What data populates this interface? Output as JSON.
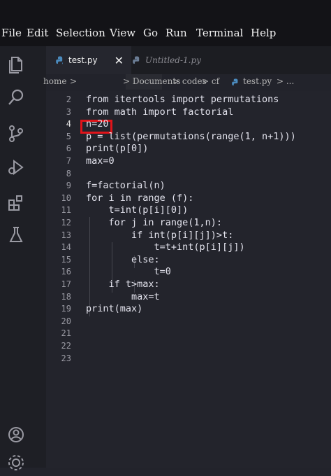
{
  "menu": {
    "items": [
      "File",
      "Edit",
      "Selection",
      "View",
      "Go",
      "Run",
      "Terminal",
      "Help"
    ]
  },
  "activity_bar": {
    "icons": [
      "files-icon",
      "search-icon",
      "source-control-icon",
      "run-debug-icon",
      "extensions-icon",
      "testing-icon",
      "account-icon",
      "settings-icon"
    ]
  },
  "tabs": [
    {
      "label": "test.py",
      "active": true
    },
    {
      "label": "Untitled-1.py",
      "active": false
    }
  ],
  "breadcrumb": {
    "home": "home",
    "home_sep": ">",
    "documents": "> Documents",
    "codes": "> codes",
    "cf": "> cf",
    "file": "test.py",
    "more": "> ..."
  },
  "editor": {
    "line_numbers": [
      "2",
      "3",
      "4",
      "5",
      "6",
      "7",
      "8",
      "9",
      "10",
      "11",
      "12",
      "13",
      "14",
      "15",
      "16",
      "17",
      "18",
      "19",
      "20",
      "21",
      "22",
      "23"
    ],
    "lines": [
      "from itertools import permutations",
      "from math import factorial",
      "n=20",
      "p = list(permutations(range(1, n+1)))",
      "print(p[0])",
      "max=0",
      "",
      "f=factorial(n)",
      "for i in range (f):",
      "    t=int(p[i][0])",
      "    for j in range(1,n):",
      "        if int(p[i][j])>t:",
      "            t=t+int(p[i][j])",
      "        else:",
      "            t=0",
      "    if t>max:",
      "        max=t",
      "print(max)",
      "",
      "",
      "",
      ""
    ],
    "highlighted_line": "4"
  },
  "colors": {
    "keyword": "#c586c0",
    "function": "#dcdcaa",
    "text": "#e4e4ee",
    "highlight_border": "#e0141a",
    "python_icon": "#4b8bbe"
  }
}
